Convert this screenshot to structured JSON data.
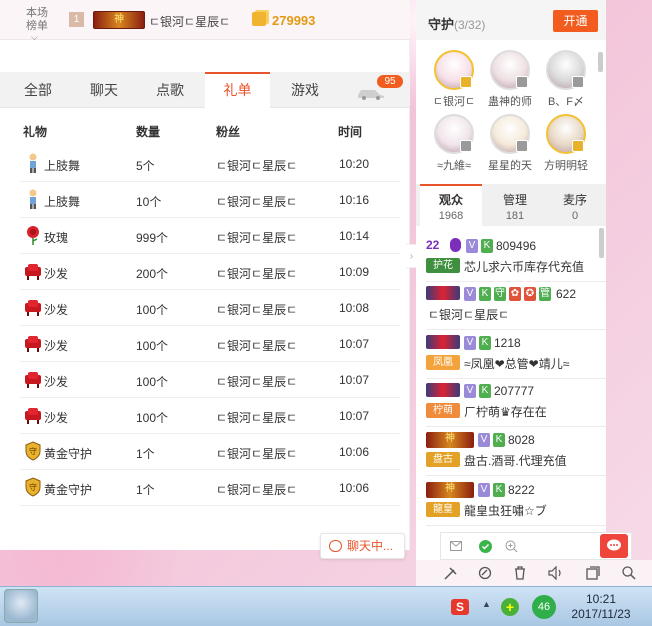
{
  "rank": {
    "label": "本场榜单",
    "chevron": "⌵",
    "position": "1",
    "badge_text": "神",
    "user": "ㄷ银河ㄷ星辰ㄷ",
    "score": "279993"
  },
  "tabs": [
    {
      "label": "全部",
      "active": false
    },
    {
      "label": "聊天",
      "active": false
    },
    {
      "label": "点歌",
      "active": false
    },
    {
      "label": "礼单",
      "active": true
    },
    {
      "label": "游戏",
      "active": false
    }
  ],
  "car_badge": "95",
  "table": {
    "headers": {
      "gift": "礼物",
      "qty": "数量",
      "fan": "粉丝",
      "time": "时间"
    },
    "rows": [
      {
        "icon": "dancer-icon",
        "gift": "上肢舞",
        "qty": "5个",
        "fan": "ㄷ银河ㄷ星辰ㄷ",
        "time": "10:20"
      },
      {
        "icon": "dancer-icon",
        "gift": "上肢舞",
        "qty": "10个",
        "fan": "ㄷ银河ㄷ星辰ㄷ",
        "time": "10:16"
      },
      {
        "icon": "rose-icon",
        "gift": "玫瑰",
        "qty": "999个",
        "fan": "ㄷ银河ㄷ星辰ㄷ",
        "time": "10:14"
      },
      {
        "icon": "sofa-icon",
        "gift": "沙发",
        "qty": "200个",
        "fan": "ㄷ银河ㄷ星辰ㄷ",
        "time": "10:09"
      },
      {
        "icon": "sofa-icon",
        "gift": "沙发",
        "qty": "100个",
        "fan": "ㄷ银河ㄷ星辰ㄷ",
        "time": "10:08"
      },
      {
        "icon": "sofa-icon",
        "gift": "沙发",
        "qty": "100个",
        "fan": "ㄷ银河ㄷ星辰ㄷ",
        "time": "10:07"
      },
      {
        "icon": "sofa-icon",
        "gift": "沙发",
        "qty": "100个",
        "fan": "ㄷ银河ㄷ星辰ㄷ",
        "time": "10:07"
      },
      {
        "icon": "sofa-icon",
        "gift": "沙发",
        "qty": "100个",
        "fan": "ㄷ银河ㄷ星辰ㄷ",
        "time": "10:07"
      },
      {
        "icon": "gold-guard-icon",
        "gift": "黄金守护",
        "qty": "1个",
        "fan": "ㄷ银河ㄷ星辰ㄷ",
        "time": "10:06"
      },
      {
        "icon": "gold-guard-icon",
        "gift": "黄金守护",
        "qty": "1个",
        "fan": "ㄷ银河ㄷ星辰ㄷ",
        "time": "10:06"
      }
    ]
  },
  "chat_button": "聊天中...",
  "guard": {
    "title": "守护",
    "count": "(3/32)",
    "open_button": "开通",
    "members": [
      {
        "name": "ㄷ银河ㄷ"
      },
      {
        "name": "蛊神的师"
      },
      {
        "name": "B、F〆"
      },
      {
        "name": "≈九維≈"
      },
      {
        "name": "星星的天"
      },
      {
        "name": "方明明轻"
      }
    ]
  },
  "audience_tabs": [
    {
      "label": "观众",
      "count": "1968",
      "active": true
    },
    {
      "label": "管理",
      "count": "181",
      "active": false
    },
    {
      "label": "麦序",
      "count": "0",
      "active": false
    }
  ],
  "audience": [
    {
      "level": "22",
      "id": "809496",
      "tag": "护花",
      "message": "芯儿求六币库存代充值"
    },
    {
      "badge": "V K 守 管",
      "id": "622",
      "message": "ㄷ银河ㄷ星辰ㄷ"
    },
    {
      "id": "1218",
      "tag": "凤凰",
      "message": "≈凤凰❤总管❤靖儿≈"
    },
    {
      "id": "207777",
      "tag": "柠萌",
      "message": "ㄏ柠萌♛存在在"
    },
    {
      "badge_text": "神",
      "id": "8028",
      "tag": "盘古",
      "message": "盘古.酒哥.代理充值"
    },
    {
      "badge_text": "神",
      "id": "8222",
      "tag": "龍皇",
      "message": "龍皇虫狂嘯☆ブ"
    }
  ],
  "taskbar": {
    "time": "10:21",
    "date": "2017/11/23",
    "notification": "46",
    "ime": "S"
  }
}
